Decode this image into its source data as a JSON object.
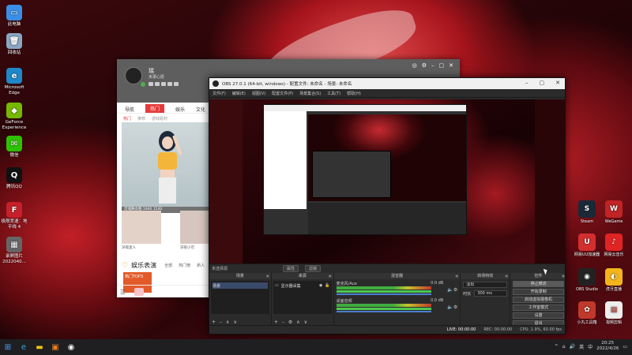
{
  "desktop": {
    "icons_left": [
      {
        "label": "此电脑",
        "color": "#3a8ee6",
        "glyph": "▭"
      },
      {
        "label": "回收站",
        "color": "#8aa7c2",
        "glyph": "🗑"
      },
      {
        "label": "Microsoft Edge",
        "color": "#1e88c9",
        "glyph": "e"
      },
      {
        "label": "GeForce Experience",
        "color": "#76b900",
        "glyph": "◆"
      },
      {
        "label": "微信",
        "color": "#2dc100",
        "glyph": "✉"
      },
      {
        "label": "腾讯QQ",
        "color": "#111111",
        "glyph": "Q"
      },
      {
        "label": "极限竞速：地平线 4",
        "color": "#c8202b",
        "glyph": "F"
      },
      {
        "label": "录屏图片 2022040...",
        "color": "#666666",
        "glyph": "▦"
      }
    ],
    "icons_right": [
      {
        "label": "Steam",
        "color": "#1b2838",
        "glyph": "S"
      },
      {
        "label": "WeGame",
        "color": "#c02424",
        "glyph": "W"
      },
      {
        "label": "网易UU加速器",
        "color": "#d32f2f",
        "glyph": "U"
      },
      {
        "label": "网易云音乐",
        "color": "#e02424",
        "glyph": "♪"
      },
      {
        "label": "OBS Studio",
        "color": "#222222",
        "glyph": "◉"
      },
      {
        "label": "虎牙直播",
        "color": "#f3b51b",
        "glyph": "◐"
      },
      {
        "label": "小丸工具箱",
        "color": "#c0392b",
        "glyph": "✿"
      },
      {
        "label": "视频剪辑",
        "color": "#eeeeee",
        "glyph": "▤"
      }
    ]
  },
  "music_app": {
    "username": "瑶",
    "user_sub": "未录心愿",
    "nav_tabs": [
      "导航",
      "热门",
      "娱乐",
      "文化"
    ],
    "active_tab": "热门",
    "subnav": [
      "热门",
      "推荐",
      "游戏题材"
    ],
    "cover_caption": "灵魂舞女图    1940 1540",
    "thumbs": [
      {
        "caption": "深夜迷人"
      },
      {
        "caption": "深夜小可"
      }
    ],
    "section_title": "娱乐表演",
    "section_tags": [
      "全部",
      "热门榜",
      "新人"
    ],
    "banner_text": "热门TOP3"
  },
  "obs": {
    "title": "OBS 27.0.1 (64-bit, windows) - 配置文件: 未命名 - 场景: 未命名",
    "menu": [
      "文件(F)",
      "编辑(E)",
      "视图(V)",
      "配置文件(P)",
      "场景集合(S)",
      "工具(T)",
      "帮助(H)"
    ],
    "toolbar_label": "未选择源",
    "toolbar_buttons": [
      "属性",
      "滤镜"
    ],
    "docks": {
      "scenes": {
        "title": "场景",
        "items": [
          "场景"
        ]
      },
      "sources": {
        "title": "来源",
        "items": [
          "显示器采集"
        ]
      },
      "mixer": {
        "title": "混音器",
        "tracks": [
          {
            "name": "麦克风/Aux",
            "db": "0.0 dB"
          },
          {
            "name": "桌面音频",
            "db": "0.0 dB"
          }
        ]
      },
      "transitions": {
        "title": "转场特效",
        "type_label": "淡出",
        "duration_label": "时长",
        "duration_value": "300 ms"
      },
      "controls": {
        "title": "控件",
        "buttons": [
          "停止推流",
          "开始录制",
          "启动虚拟摄像机",
          "工作室模式",
          "设置",
          "退出"
        ]
      }
    },
    "status": {
      "live": "LIVE: 00:00:00",
      "rec": "REC: 00:00:00",
      "cpu": "CPU: 1.9%, 60.00 fps"
    }
  },
  "taskbar": {
    "time": "20:25",
    "date": "2022/4/26",
    "tray": [
      "^",
      "英",
      "中"
    ]
  },
  "colors": {
    "accent_red": "#e63a3a",
    "obs_bg": "#2b2b2b"
  }
}
